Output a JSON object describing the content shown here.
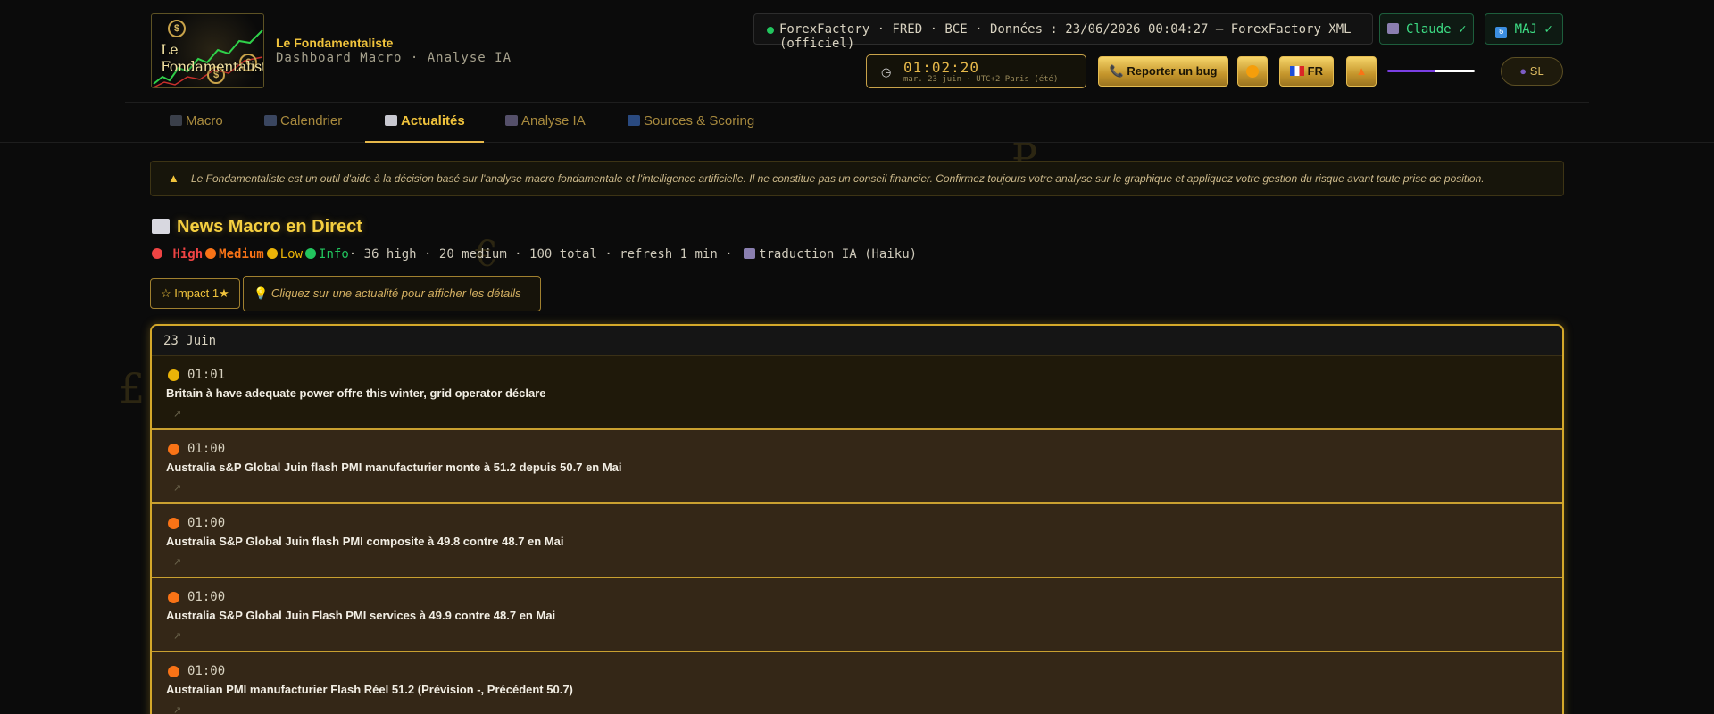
{
  "header": {
    "brand_title": "Le Fondamentaliste",
    "brand_subtitle": "Dashboard Macro · Analyse IA",
    "logo_text": "Le Fondamentaliste",
    "sources_status": "ForexFactory · FRED · BCE · Données : 23/06/2026 00:04:27 — ForexFactory XML (officiel)",
    "ai_pill": "Claude ✓",
    "update_pill": "MAJ ✓",
    "clock_time": "01:02:20",
    "clock_date": "mar. 23 juin · UTC+2 Paris (été)",
    "report_bug": "Reporter un bug",
    "language": "FR",
    "user_initials": "SL",
    "status_color": "#22c55e",
    "accent": "#f0c33c"
  },
  "nav": {
    "tabs": [
      {
        "label": "Macro",
        "icon": "chart-icon",
        "active": false
      },
      {
        "label": "Calendrier",
        "icon": "calendar-icon",
        "active": false
      },
      {
        "label": "Actualités",
        "icon": "newspaper-icon",
        "active": true
      },
      {
        "label": "Analyse IA",
        "icon": "robot-icon",
        "active": false
      },
      {
        "label": "Sources & Scoring",
        "icon": "info-icon",
        "active": false
      }
    ]
  },
  "disclaimer": "Le Fondamentaliste est un outil d'aide à la décision basé sur l'analyse macro fondamentale et l'intelligence artificielle. Il ne constitue pas un conseil financier. Confirmez toujours votre analyse sur le graphique et appliquez votre gestion du risque avant toute prise de position.",
  "news": {
    "heading": "News Macro en Direct",
    "legend": {
      "high": "High",
      "medium": "Medium",
      "low": "Low",
      "info": "Info",
      "stats": "· 36 high · 20 medium · 100 total · refresh 1 min ·",
      "translation": "traduction IA (Haiku)",
      "colors": {
        "high": "#ef4444",
        "medium": "#f97316",
        "low": "#eab308",
        "info": "#22c55e"
      }
    },
    "filter_button": "☆ Impact 1★",
    "hint": "Cliquez sur une actualité pour afficher les détails",
    "day_label": "23 Juin",
    "items": [
      {
        "time": "01:01",
        "impact": "low",
        "title": "Britain à have adequate power offre this winter, grid operator déclare",
        "link": "↗"
      },
      {
        "time": "01:00",
        "impact": "medium",
        "title": "Australia s&P Global Juin flash PMI manufacturier monte à 51.2 depuis 50.7 en Mai",
        "link": "↗"
      },
      {
        "time": "01:00",
        "impact": "medium",
        "title": "Australia S&P Global Juin flash PMI composite à 49.8 contre 48.7 en Mai",
        "link": "↗"
      },
      {
        "time": "01:00",
        "impact": "medium",
        "title": "Australia S&P Global Juin Flash PMI services à 49.9 contre 48.7 en Mai",
        "link": "↗"
      },
      {
        "time": "01:00",
        "impact": "medium",
        "title": "Australian PMI manufacturier Flash Réel 51.2 (Prévision -, Précédent 50.7)",
        "link": "↗"
      }
    ]
  }
}
